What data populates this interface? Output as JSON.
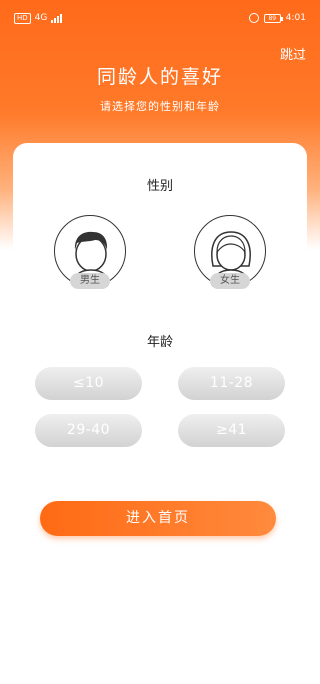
{
  "status_bar": {
    "network_badge": "HD",
    "network_type": "4G",
    "battery_level": "89",
    "time": "4:01"
  },
  "header": {
    "skip_label": "跳过",
    "title": "同龄人的喜好",
    "subtitle": "请选择您的性别和年龄"
  },
  "gender": {
    "section_label": "性别",
    "options": [
      {
        "label": "男生",
        "icon": "male-avatar-icon"
      },
      {
        "label": "女生",
        "icon": "female-avatar-icon"
      }
    ]
  },
  "age": {
    "section_label": "年龄",
    "options": [
      "≤10",
      "11-28",
      "29-40",
      "≥41"
    ]
  },
  "actions": {
    "enter_label": "进入首页"
  },
  "colors": {
    "accent": "#ff6a14",
    "age_button": "#d9d9d9",
    "tag": "#d6d6d6"
  }
}
